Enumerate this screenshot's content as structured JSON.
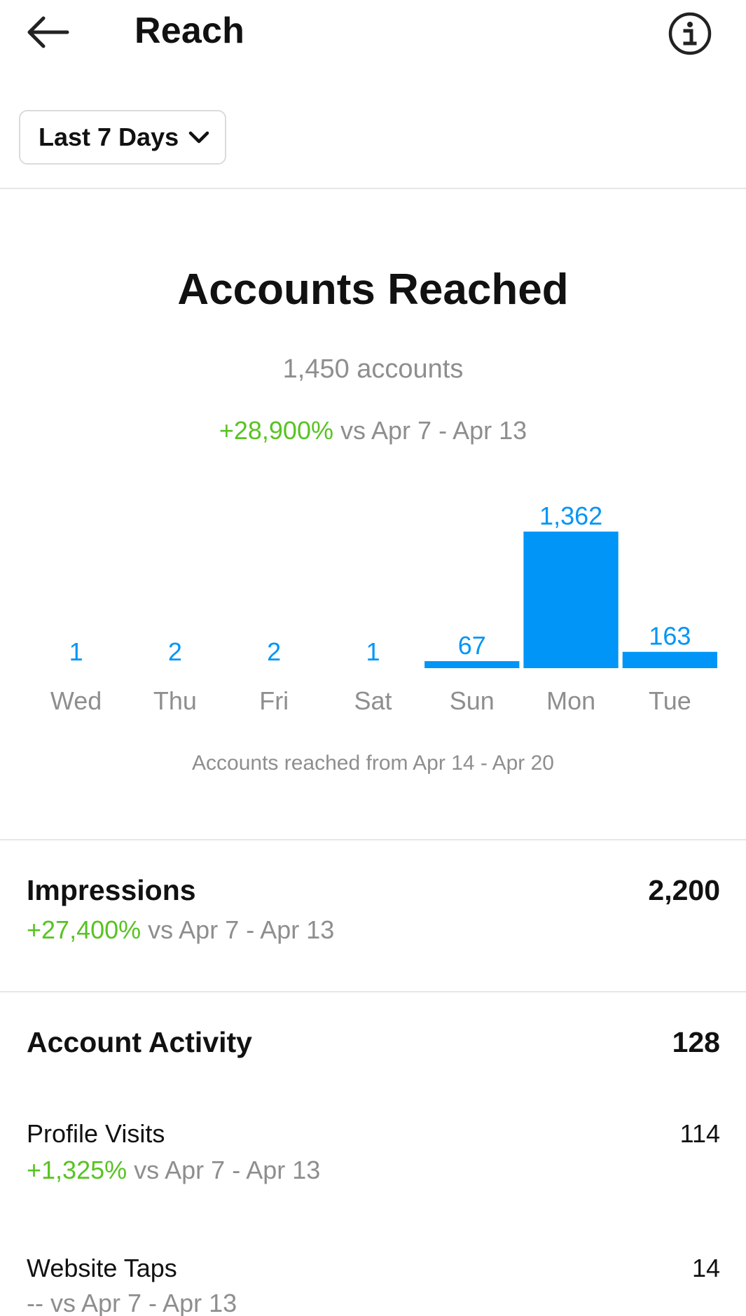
{
  "header": {
    "title": "Reach",
    "back_icon": "arrow-left-icon",
    "info_icon": "info-circle-icon"
  },
  "range": {
    "label": "Last 7 Days",
    "icon": "chevron-down-icon"
  },
  "accounts_reached": {
    "title": "Accounts Reached",
    "count_text": "1,450 accounts",
    "change": "+28,900%",
    "comparison": " vs Apr 7 - Apr 13",
    "caption": "Accounts reached from Apr 14 - Apr 20"
  },
  "chart_data": {
    "type": "bar",
    "categories": [
      "Wed",
      "Thu",
      "Fri",
      "Sat",
      "Sun",
      "Mon",
      "Tue"
    ],
    "values": [
      1,
      2,
      2,
      1,
      67,
      1362,
      163
    ],
    "value_labels": [
      "1",
      "2",
      "2",
      "1",
      "67",
      "1,362",
      "163"
    ],
    "title": "",
    "xlabel": "",
    "ylabel": "",
    "ylim": [
      0,
      1362
    ],
    "grid": false,
    "bar_color": "#0095f6",
    "label_color": "#0095f6",
    "tick_color": "#8e8e8e"
  },
  "impressions": {
    "label": "Impressions",
    "value": "2,200",
    "change": "+27,400%",
    "comparison": " vs Apr 7 - Apr 13"
  },
  "account_activity": {
    "label": "Account Activity",
    "value": "128",
    "profile_visits": {
      "label": "Profile Visits",
      "value": "114",
      "change": "+1,325%",
      "comparison": " vs Apr 7 - Apr 13"
    },
    "website_taps": {
      "label": "Website Taps",
      "value": "14",
      "change": "--",
      "comparison": " vs Apr 7 - Apr 13"
    }
  },
  "colors": {
    "accent": "#0095f6",
    "positive": "#58c322",
    "muted": "#8e8e8e",
    "divider": "#e6e6e6"
  }
}
